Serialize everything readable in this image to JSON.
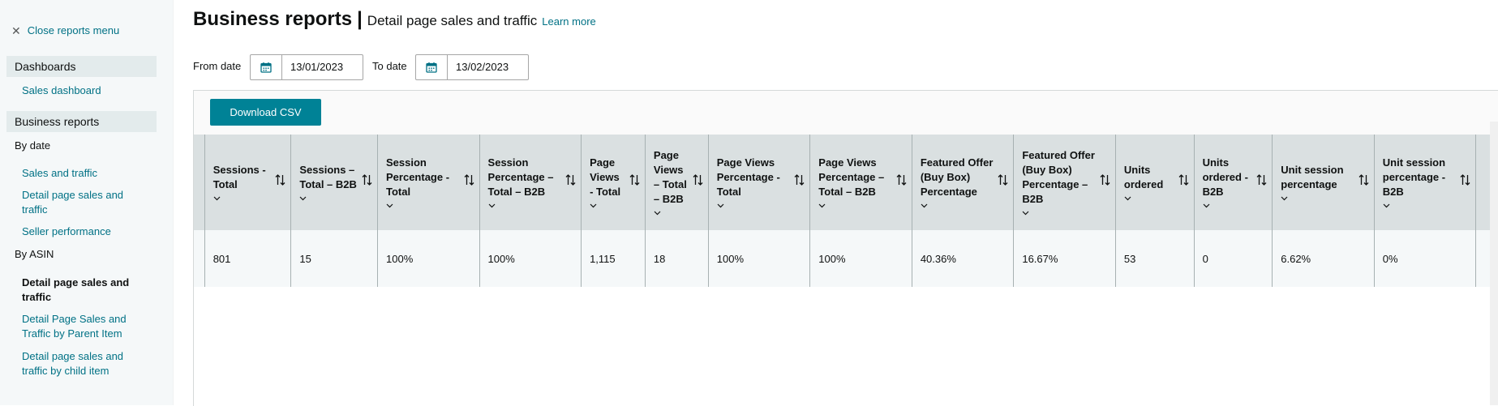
{
  "sidebar": {
    "close_label": "Close reports menu",
    "dashboards": {
      "header": "Dashboards",
      "items": [
        "Sales dashboard"
      ]
    },
    "business_reports": {
      "header": "Business reports",
      "by_date_label": "By date",
      "by_date_items": [
        "Sales and traffic",
        "Detail page sales and traffic",
        "Seller performance"
      ],
      "by_asin_label": "By ASIN",
      "by_asin_items": [
        "Detail page sales and traffic",
        "Detail Page Sales and Traffic by Parent Item",
        "Detail page sales and traffic by child item"
      ],
      "active_item": "Detail page sales and traffic"
    }
  },
  "header": {
    "title": "Business reports",
    "separator": "|",
    "subtitle": "Detail page sales and traffic",
    "learn_more": "Learn more"
  },
  "filters": {
    "from_label": "From date",
    "from_value": "13/01/2023",
    "to_label": "To date",
    "to_value": "13/02/2023"
  },
  "toolbar": {
    "download_label": "Download CSV"
  },
  "table": {
    "columns": [
      "Sessions - Total",
      "Sessions – Total – B2B",
      "Session Percentage - Total",
      "Session Percentage – Total – B2B",
      "Page Views - Total",
      "Page Views – Total – B2B",
      "Page Views Percentage - Total",
      "Page Views Percentage – Total – B2B",
      "Featured Offer (Buy Box) Percentage",
      "Featured Offer (Buy Box) Percentage – B2B",
      "Units ordered",
      "Units ordered - B2B",
      "Unit session percentage",
      "Unit session percentage - B2B"
    ],
    "rows": [
      [
        "801",
        "15",
        "100%",
        "100%",
        "1,115",
        "18",
        "100%",
        "100%",
        "40.36%",
        "16.67%",
        "53",
        "0",
        "6.62%",
        "0%"
      ]
    ]
  },
  "icons": {
    "close": "close-icon",
    "calendar": "calendar-icon",
    "sort": "sort-icon",
    "chevron": "chevron-down-icon"
  },
  "colors": {
    "link": "#007185",
    "button": "#008296",
    "header_bg": "#dae0e1",
    "row_bg": "#f5f8f9",
    "sidebar_bg": "#f5f8f9"
  }
}
